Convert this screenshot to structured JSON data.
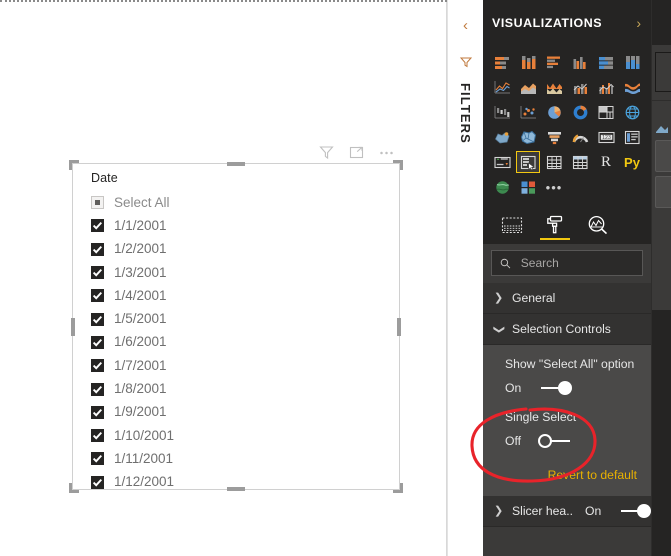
{
  "canvas": {
    "visual_toolbar": [
      {
        "name": "filter-icon",
        "label": "Filters"
      },
      {
        "name": "focus-mode-icon",
        "label": "Focus mode"
      },
      {
        "name": "more-options-icon",
        "label": "More options"
      }
    ],
    "slicer": {
      "title": "Date",
      "select_all_label": "Select All",
      "select_all_state": "partial",
      "items": [
        {
          "label": "1/1/2001",
          "checked": true
        },
        {
          "label": "1/2/2001",
          "checked": true
        },
        {
          "label": "1/3/2001",
          "checked": true
        },
        {
          "label": "1/4/2001",
          "checked": true
        },
        {
          "label": "1/5/2001",
          "checked": true
        },
        {
          "label": "1/6/2001",
          "checked": true
        },
        {
          "label": "1/7/2001",
          "checked": true
        },
        {
          "label": "1/8/2001",
          "checked": true
        },
        {
          "label": "1/9/2001",
          "checked": true
        },
        {
          "label": "1/10/2001",
          "checked": true
        },
        {
          "label": "1/11/2001",
          "checked": true
        },
        {
          "label": "1/12/2001",
          "checked": true
        }
      ]
    }
  },
  "filters_rail": {
    "collapse_label": "‹",
    "title": "FILTERS"
  },
  "visualizations": {
    "header_title": "VISUALIZATIONS",
    "expand_label": "›",
    "gallery": [
      {
        "name": "stacked-bar-chart-icon"
      },
      {
        "name": "stacked-column-chart-icon"
      },
      {
        "name": "clustered-bar-chart-icon"
      },
      {
        "name": "clustered-column-chart-icon"
      },
      {
        "name": "hundred-percent-stacked-bar-chart-icon"
      },
      {
        "name": "hundred-percent-stacked-column-chart-icon"
      },
      {
        "name": "line-chart-icon"
      },
      {
        "name": "area-chart-icon"
      },
      {
        "name": "stacked-area-chart-icon"
      },
      {
        "name": "line-and-stacked-column-chart-icon"
      },
      {
        "name": "line-and-clustered-column-chart-icon"
      },
      {
        "name": "ribbon-chart-icon"
      },
      {
        "name": "waterfall-chart-icon"
      },
      {
        "name": "scatter-chart-icon"
      },
      {
        "name": "pie-chart-icon"
      },
      {
        "name": "donut-chart-icon"
      },
      {
        "name": "treemap-icon"
      },
      {
        "name": "map-icon"
      },
      {
        "name": "filled-map-icon"
      },
      {
        "name": "shape-map-icon"
      },
      {
        "name": "funnel-chart-icon"
      },
      {
        "name": "gauge-chart-icon"
      },
      {
        "name": "card-icon"
      },
      {
        "name": "multi-row-card-icon"
      },
      {
        "name": "kpi-icon"
      },
      {
        "name": "slicer-icon"
      },
      {
        "name": "table-icon"
      },
      {
        "name": "matrix-icon"
      },
      {
        "name": "r-script-visual-icon",
        "text": "R"
      },
      {
        "name": "python-visual-icon",
        "text": "Py"
      },
      {
        "name": "arcgis-maps-icon"
      },
      {
        "name": "get-more-visuals-icon"
      },
      {
        "name": "more-visuals-ellipsis-icon",
        "text": "•••"
      }
    ],
    "selected_visual": "slicer-icon",
    "tabs": [
      {
        "name": "fields-tab",
        "label": "Fields",
        "active": false
      },
      {
        "name": "format-tab",
        "label": "Format",
        "active": true
      },
      {
        "name": "analytics-tab",
        "label": "Analytics",
        "active": false
      }
    ],
    "search": {
      "placeholder": "Search",
      "value": ""
    },
    "sections": [
      {
        "name": "general",
        "label": "General",
        "expanded": false
      },
      {
        "name": "selection-controls",
        "label": "Selection Controls",
        "expanded": true,
        "properties": [
          {
            "name": "show-select-all-option",
            "label": "Show \"Select All\" option",
            "state": "On",
            "on": true
          },
          {
            "name": "single-select",
            "label": "Single Select",
            "state": "Off",
            "on": false,
            "highlighted": true
          }
        ],
        "revert_label": "Revert to default"
      },
      {
        "name": "slicer-header",
        "label": "Slicer hea...",
        "expanded": false,
        "state": "On",
        "on": true
      }
    ]
  },
  "annotation": {
    "name": "red-ellipse-highlight",
    "color": "#e8232a",
    "targets": "Single Select toggle"
  },
  "colors": {
    "pane_bg": "#3b3a39",
    "pane_header_bg": "#252423",
    "section_head_bg": "#333231",
    "section_body_bg": "#4a4948",
    "accent_yellow": "#f2c811",
    "revert_link": "#e8b100",
    "canvas_bg": "#ffffff",
    "annotation_red": "#e8232a"
  }
}
